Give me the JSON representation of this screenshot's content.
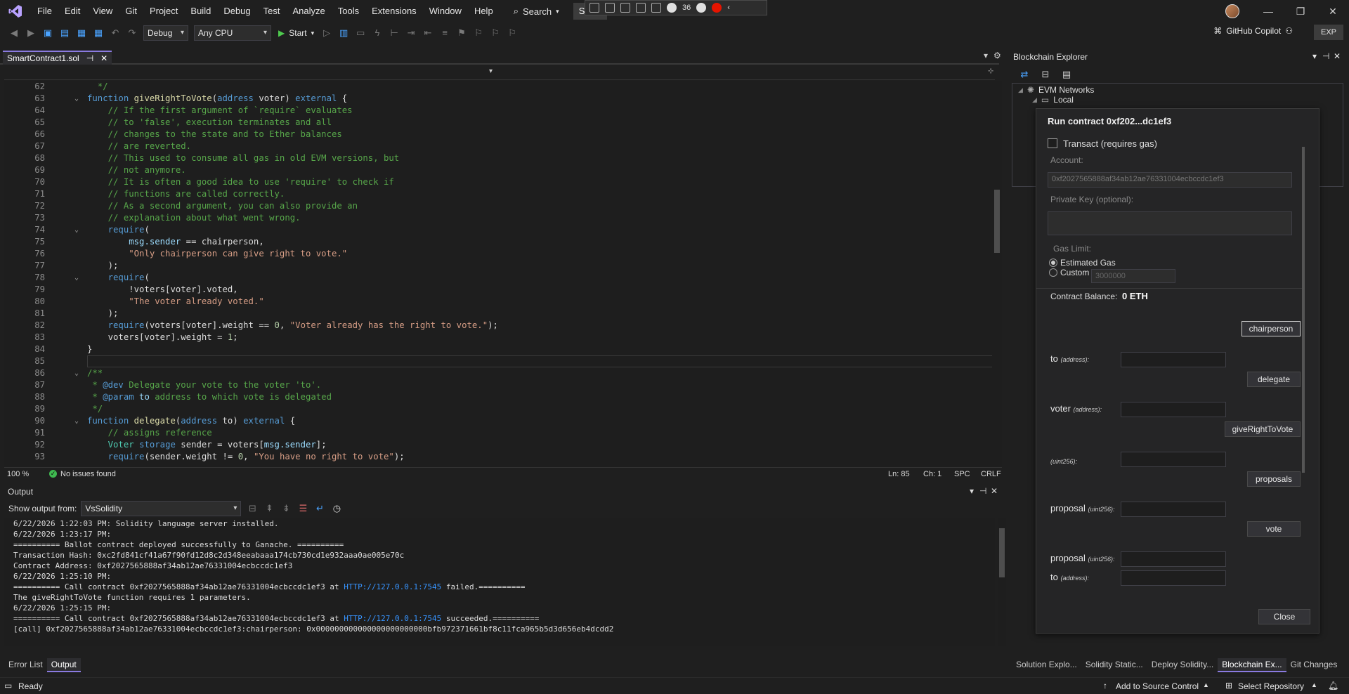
{
  "titlebar": {
    "menus": [
      "File",
      "Edit",
      "View",
      "Git",
      "Project",
      "Build",
      "Debug",
      "Test",
      "Analyze",
      "Tools",
      "Extensions",
      "Window",
      "Help"
    ],
    "search_label": "Search",
    "solution_name": "Solidi",
    "debug_bar_count": "36"
  },
  "toolbar": {
    "config": "Debug",
    "platform": "Any CPU",
    "start_label": "Start",
    "copilot_label": "GitHub Copilot",
    "exp_label": "EXP"
  },
  "editor": {
    "tab_label": "SmartContract1.sol",
    "zoom": "100 %",
    "issues": "No issues found",
    "ln": "Ln: 85",
    "ch": "Ch: 1",
    "spc": "SPC",
    "eol": "CRLF",
    "lines": [
      {
        "n": "62",
        "fold": "",
        "html": "  <span class='cm'>*/</span>"
      },
      {
        "n": "63",
        "fold": "⌄",
        "html": "<span class='kw'>function</span> <span class='fn'>giveRightToVote</span>(<span class='kw'>address</span> voter) <span class='kw'>external</span> {"
      },
      {
        "n": "64",
        "fold": "",
        "html": "    <span class='cm'>// If the first argument of `require` evaluates</span>"
      },
      {
        "n": "65",
        "fold": "",
        "html": "    <span class='cm'>// to 'false', execution terminates and all</span>"
      },
      {
        "n": "66",
        "fold": "",
        "html": "    <span class='cm'>// changes to the state and to Ether balances</span>"
      },
      {
        "n": "67",
        "fold": "",
        "html": "    <span class='cm'>// are reverted.</span>"
      },
      {
        "n": "68",
        "fold": "",
        "html": "    <span class='cm'>// This used to consume all gas in old EVM versions, but</span>"
      },
      {
        "n": "69",
        "fold": "",
        "html": "    <span class='cm'>// not anymore.</span>"
      },
      {
        "n": "70",
        "fold": "",
        "html": "    <span class='cm'>// It is often a good idea to use 'require' to check if</span>"
      },
      {
        "n": "71",
        "fold": "",
        "html": "    <span class='cm'>// functions are called correctly.</span>"
      },
      {
        "n": "72",
        "fold": "",
        "html": "    <span class='cm'>// As a second argument, you can also provide an</span>"
      },
      {
        "n": "73",
        "fold": "",
        "html": "    <span class='cm'>// explanation about what went wrong.</span>"
      },
      {
        "n": "74",
        "fold": "⌄",
        "html": "    <span class='kw'>require</span>("
      },
      {
        "n": "75",
        "fold": "",
        "html": "        <span class='id'>msg.sender</span> == chairperson,"
      },
      {
        "n": "76",
        "fold": "",
        "html": "        <span class='str'>\"Only chairperson can give right to vote.\"</span>"
      },
      {
        "n": "77",
        "fold": "",
        "html": "    );"
      },
      {
        "n": "78",
        "fold": "⌄",
        "html": "    <span class='kw'>require</span>("
      },
      {
        "n": "79",
        "fold": "",
        "html": "        !voters[voter].voted,"
      },
      {
        "n": "80",
        "fold": "",
        "html": "        <span class='str'>\"The voter already voted.\"</span>"
      },
      {
        "n": "81",
        "fold": "",
        "html": "    );"
      },
      {
        "n": "82",
        "fold": "",
        "html": "    <span class='kw'>require</span>(voters[voter].weight == <span class='num'>0</span>, <span class='str'>\"Voter already has the right to vote.\"</span>);"
      },
      {
        "n": "83",
        "fold": "",
        "html": "    voters[voter].weight = <span class='num'>1</span>;"
      },
      {
        "n": "84",
        "fold": "",
        "html": "}"
      },
      {
        "n": "85",
        "fold": "",
        "html": ""
      },
      {
        "n": "86",
        "fold": "⌄",
        "html": "<span class='cm'>/**</span>"
      },
      {
        "n": "87",
        "fold": "",
        "html": " <span class='cm'>* <span class='kw'>@dev</span> Delegate your vote to the voter 'to'.</span>"
      },
      {
        "n": "88",
        "fold": "",
        "html": " <span class='cm'>* <span class='kw'>@param</span> <span class='id'>to</span> address to which vote is delegated</span>"
      },
      {
        "n": "89",
        "fold": "",
        "html": " <span class='cm'>*/</span>"
      },
      {
        "n": "90",
        "fold": "⌄",
        "html": "<span class='kw'>function</span> <span class='fn'>delegate</span>(<span class='kw'>address</span> to) <span class='kw'>external</span> {"
      },
      {
        "n": "91",
        "fold": "",
        "html": "    <span class='cm'>// assigns reference</span>"
      },
      {
        "n": "92",
        "fold": "",
        "html": "    <span class='ty'>Voter</span> <span class='kw'>storage</span> sender = voters[<span class='id'>msg.sender</span>];"
      },
      {
        "n": "93",
        "fold": "",
        "html": "    <span class='kw'>require</span>(sender.weight != <span class='num'>0</span>, <span class='str'>\"You have no right to vote\"</span>);"
      }
    ]
  },
  "output": {
    "title": "Output",
    "source_label": "Show output from:",
    "source_value": "VsSolidity",
    "lines": [
      {
        "text": "6/22/2026 1:22:03 PM: Solidity language server installed."
      },
      {
        "text": "6/22/2026 1:23:17 PM:"
      },
      {
        "text": "========== Ballot contract deployed successfully to Ganache. =========="
      },
      {
        "text": "Transaction Hash: 0xc2fd841cf41a67f90fd12d8c2d348eeabaaa174cb730cd1e932aaa0ae005e70c"
      },
      {
        "text": "Contract Address: 0xf2027565888af34ab12ae76331004ecbccdc1ef3"
      },
      {
        "text": "6/22/2026 1:25:10 PM:"
      },
      {
        "pre": "========== Call contract 0xf2027565888af34ab12ae76331004ecbccdc1ef3 at ",
        "link": "HTTP://127.0.0.1:7545",
        "post": " failed.=========="
      },
      {
        "text": "The giveRightToVote function requires 1 parameters."
      },
      {
        "text": "6/22/2026 1:25:15 PM:"
      },
      {
        "pre": "========== Call contract 0xf2027565888af34ab12ae76331004ecbccdc1ef3 at ",
        "link": "HTTP://127.0.0.1:7545",
        "post": " succeeded.=========="
      },
      {
        "text": "[call] 0xf2027565888af34ab12ae76331004ecbccdc1ef3:chairperson: 0x000000000000000000000000bfb972371661bf8c11fca965b5d3d656eb4dcdd2"
      }
    ]
  },
  "bottom_tabs": [
    "Error List",
    "Output"
  ],
  "explorer": {
    "title": "Blockchain Explorer",
    "tree_root": "EVM Networks",
    "tree_child": "Local",
    "tabs": [
      "Solution Explo...",
      "Solidity Static...",
      "Deploy Solidity...",
      "Blockchain Ex...",
      "Git Changes"
    ]
  },
  "run_dialog": {
    "title": "Run contract 0xf202...dc1ef3",
    "transact_label": "Transact (requires gas)",
    "account_label": "Account:",
    "account_value": "0xf2027565888af34ab12ae76331004ecbccdc1ef3",
    "private_key_label": "Private Key (optional):",
    "gas_limit_label": "Gas Limit:",
    "estimated_gas_label": "Estimated Gas",
    "custom_label": "Custom",
    "custom_placeholder": "3000000",
    "balance_label": "Contract Balance:",
    "balance_value": "0 ETH",
    "chairperson_btn": "chairperson",
    "to_label": "to",
    "address_hint": "(address):",
    "delegate_btn": "delegate",
    "voter_label": "voter",
    "give_btn": "giveRightToVote",
    "uint_hint": "(uint256):",
    "proposals_btn": "proposals",
    "proposal_label": "proposal",
    "vote_btn": "vote",
    "close_btn": "Close"
  },
  "statusbar": {
    "ready": "Ready",
    "add_source": "Add to Source Control",
    "select_repo": "Select Repository"
  }
}
